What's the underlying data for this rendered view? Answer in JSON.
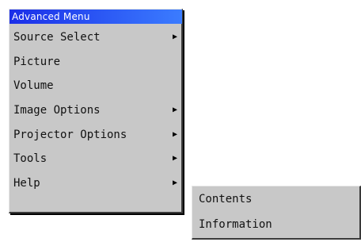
{
  "menu": {
    "title": "Advanced Menu",
    "items": [
      {
        "label": "Source Select",
        "has_submenu": true
      },
      {
        "label": "Picture",
        "has_submenu": false
      },
      {
        "label": "Volume",
        "has_submenu": false
      },
      {
        "label": "Image Options",
        "has_submenu": true
      },
      {
        "label": "Projector Options",
        "has_submenu": true
      },
      {
        "label": "Tools",
        "has_submenu": true
      },
      {
        "label": "Help",
        "has_submenu": true
      }
    ],
    "arrow_glyph": "▶"
  },
  "submenu": {
    "items": [
      {
        "label": "Contents"
      },
      {
        "label": "Information"
      }
    ]
  },
  "colors": {
    "menu_background": "#c8c8c8",
    "title_gradient_start": "#1a2ee8",
    "title_gradient_end": "#3b7cff",
    "title_text": "#ffffff"
  }
}
